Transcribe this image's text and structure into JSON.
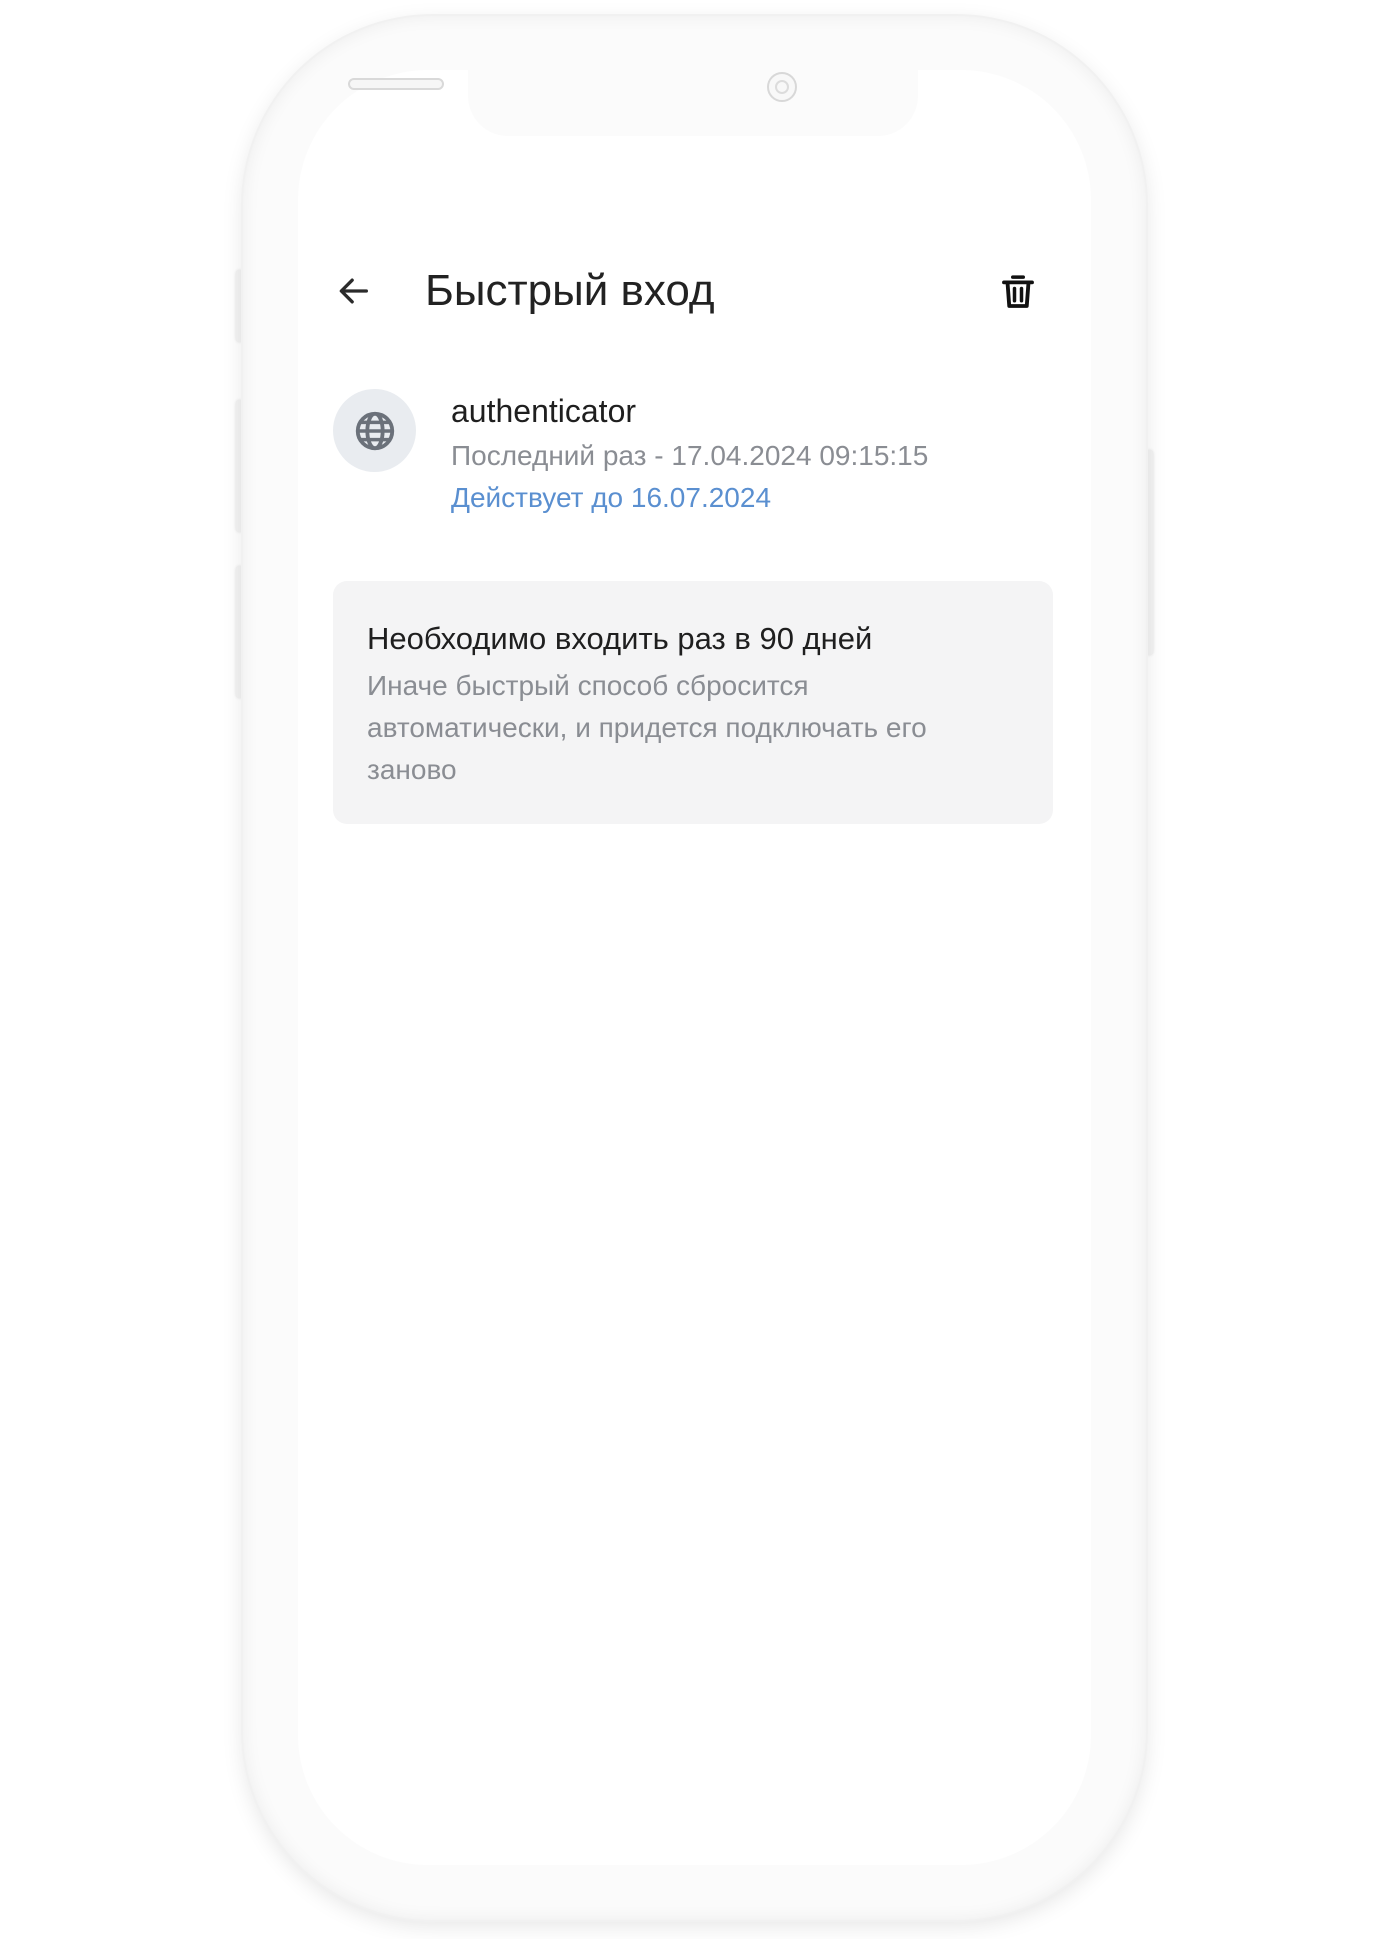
{
  "header": {
    "title": "Быстрый вход",
    "back_icon": "arrow-left-icon",
    "delete_icon": "trash-icon"
  },
  "item": {
    "icon": "globe-icon",
    "name": "authenticator",
    "last_used": "Последний раз - 17.04.2024 09:15:15",
    "valid_until": "Действует до 16.07.2024"
  },
  "info": {
    "title": "Необходимо входить раз в 90 дней",
    "body": "Иначе быстрый способ сбросится автоматически, и придется подключать его заново"
  },
  "colors": {
    "accent": "#5a8fd0",
    "secondary_text": "#8a8d93",
    "card_bg": "#f4f4f5",
    "icon_bg": "#e9ecf0"
  }
}
